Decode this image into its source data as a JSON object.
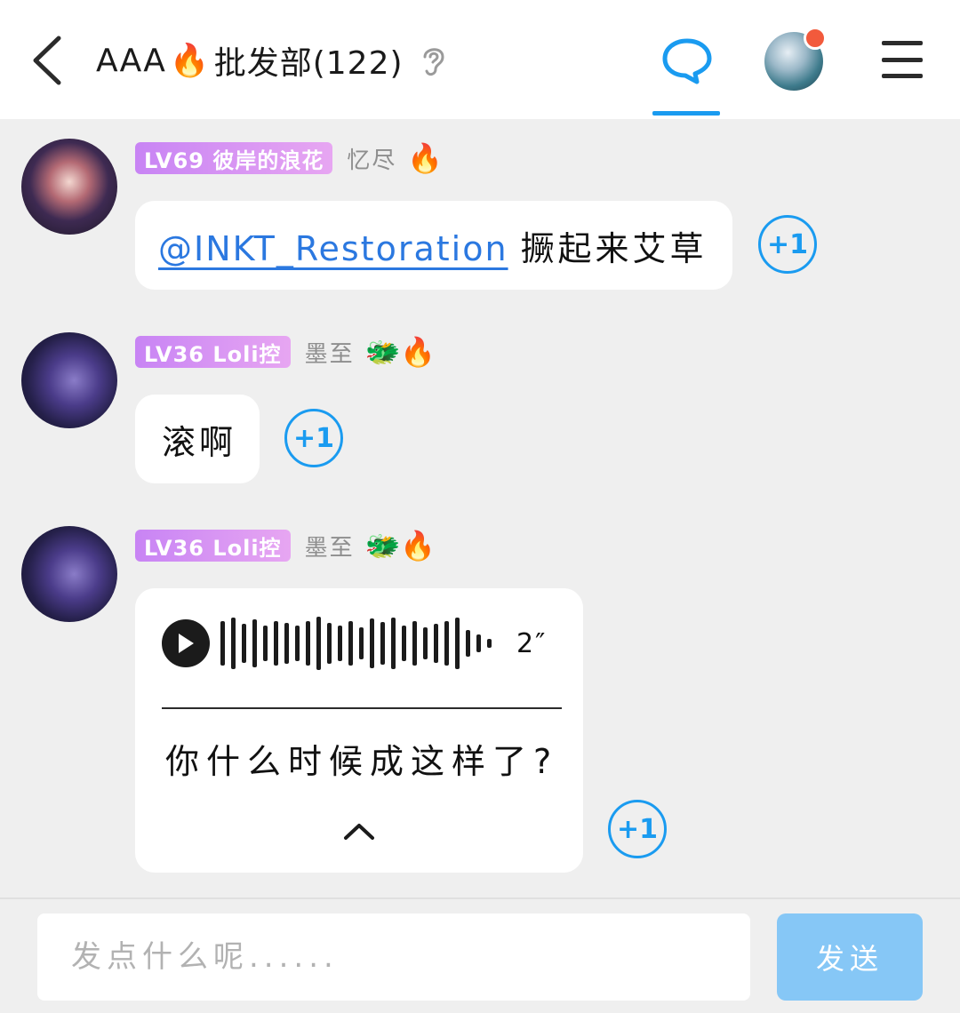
{
  "header": {
    "title_prefix": "AAA",
    "title_emoji": "🔥",
    "title_suffix": "批发部(122)",
    "icons": [
      "back-arrow-icon",
      "ear-icon",
      "chat-bubble-icon",
      "menu-icon"
    ]
  },
  "messages": [
    {
      "level": "LV69 彼岸的浪花",
      "nickname": "忆尽",
      "emojis": "🔥",
      "mention": "@INKT_Restoration",
      "text": "撅起来艾草",
      "plus_one": "+1"
    },
    {
      "level": "LV36 Loli控",
      "nickname": "墨至",
      "emojis": "🐲🔥",
      "text": "滚啊",
      "plus_one": "+1"
    },
    {
      "level": "LV36 Loli控",
      "nickname": "墨至",
      "emojis": "🐲🔥",
      "voice_duration": "2″",
      "transcript": "你什么时候成这样了?",
      "plus_one": "+1"
    }
  ],
  "composer": {
    "placeholder": "发点什么呢......",
    "send_label": "发送"
  },
  "colors": {
    "accent": "#1a9bf0",
    "badge_gradient": [
      "#c884f4",
      "#e7a6f2"
    ],
    "send_button": "#86c7f6",
    "notification_dot": "#f25a3c"
  }
}
